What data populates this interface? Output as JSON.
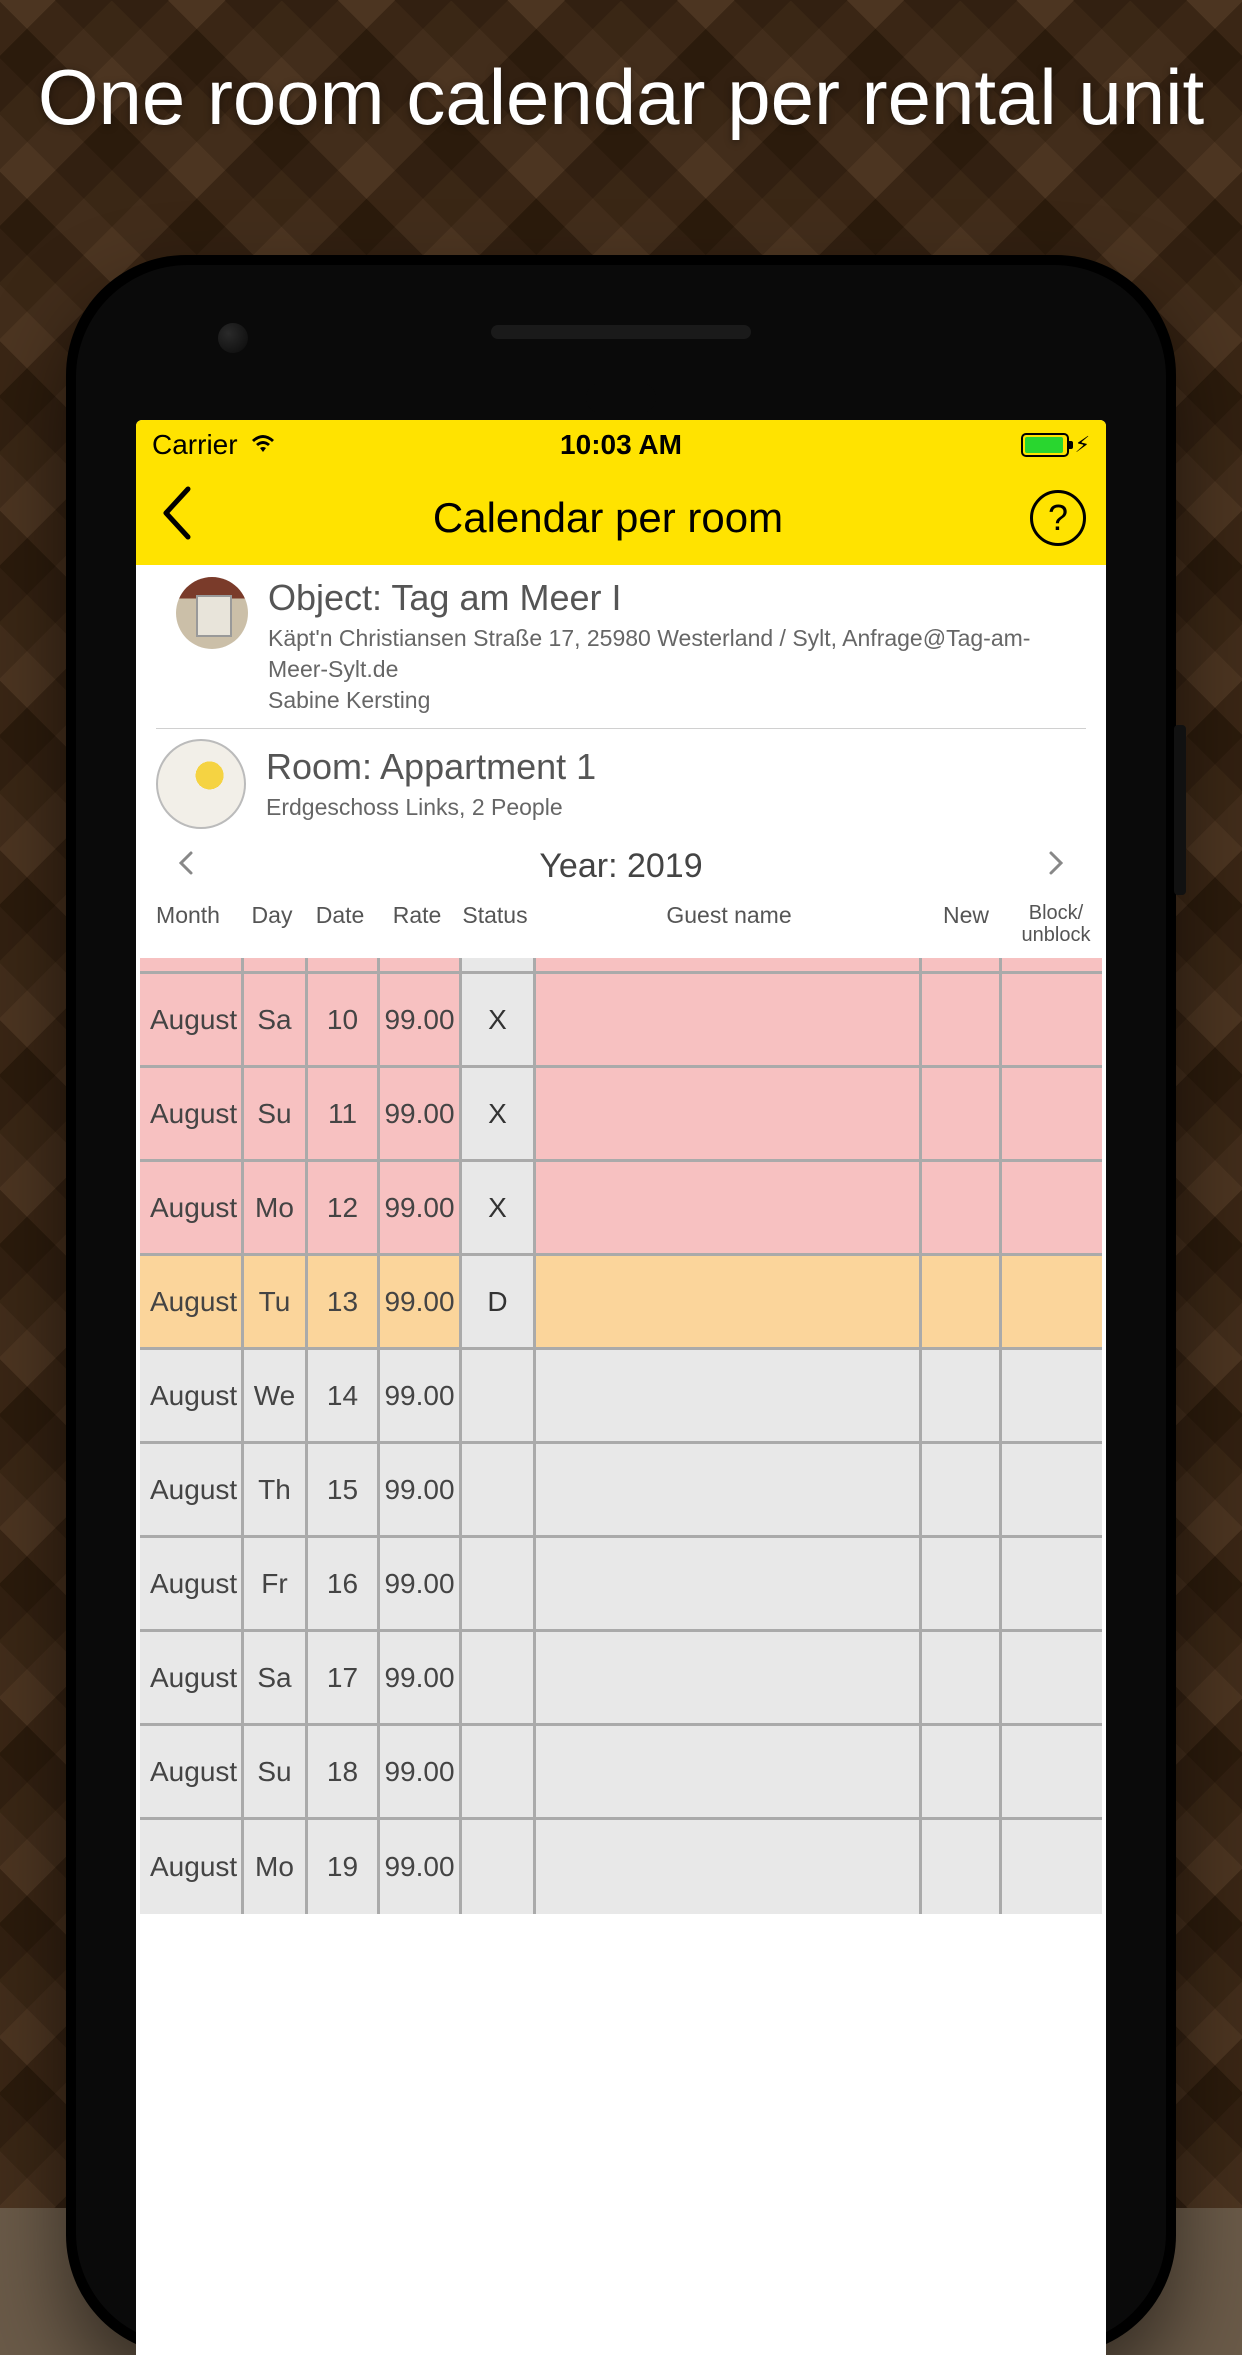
{
  "promo": {
    "headline": "One room calendar per rental unit"
  },
  "status": {
    "carrier": "Carrier",
    "time": "10:03 AM"
  },
  "nav": {
    "title": "Calendar per room",
    "help_label": "?"
  },
  "object": {
    "title": "Object: Tag am Meer I",
    "address": "Käpt'n Christiansen Straße 17, 25980 Westerland / Sylt, Anfrage@Tag-am-Meer-Sylt.de",
    "owner": "Sabine Kersting"
  },
  "room": {
    "title": "Room: Appartment 1",
    "subtitle": "Erdgeschoss Links, 2 People"
  },
  "year": {
    "label": "Year: 2019"
  },
  "columns": {
    "month": "Month",
    "day": "Day",
    "date": "Date",
    "rate": "Rate",
    "status": "Status",
    "guest": "Guest name",
    "new": "New",
    "block": "Block/ unblock"
  },
  "rows": [
    {
      "month": "August",
      "day": "Sa",
      "date": "10",
      "rate": "99.00",
      "status": "X",
      "state": "pink"
    },
    {
      "month": "August",
      "day": "Su",
      "date": "11",
      "rate": "99.00",
      "status": "X",
      "state": "pink"
    },
    {
      "month": "August",
      "day": "Mo",
      "date": "12",
      "rate": "99.00",
      "status": "X",
      "state": "pink"
    },
    {
      "month": "August",
      "day": "Tu",
      "date": "13",
      "rate": "99.00",
      "status": "D",
      "state": "orange"
    },
    {
      "month": "August",
      "day": "We",
      "date": "14",
      "rate": "99.00",
      "status": "",
      "state": "plain"
    },
    {
      "month": "August",
      "day": "Th",
      "date": "15",
      "rate": "99.00",
      "status": "",
      "state": "plain"
    },
    {
      "month": "August",
      "day": "Fr",
      "date": "16",
      "rate": "99.00",
      "status": "",
      "state": "plain"
    },
    {
      "month": "August",
      "day": "Sa",
      "date": "17",
      "rate": "99.00",
      "status": "",
      "state": "plain"
    },
    {
      "month": "August",
      "day": "Su",
      "date": "18",
      "rate": "99.00",
      "status": "",
      "state": "plain"
    },
    {
      "month": "August",
      "day": "Mo",
      "date": "19",
      "rate": "99.00",
      "status": "",
      "state": "plain"
    }
  ]
}
